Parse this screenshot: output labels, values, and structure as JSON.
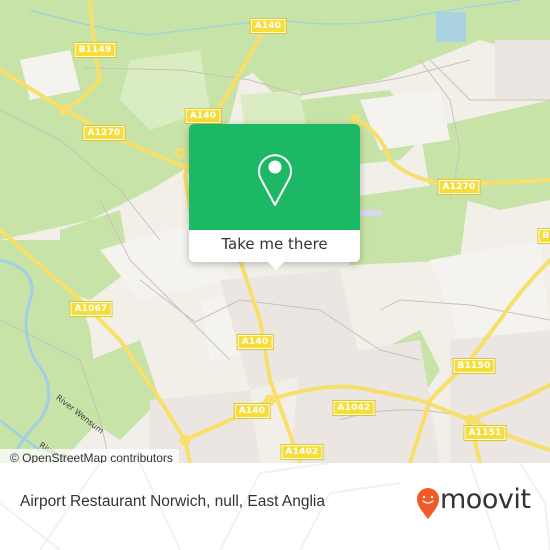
{
  "map": {
    "road_labels": [
      {
        "id": "b1149",
        "text": "B1149"
      },
      {
        "id": "a140-top",
        "text": "A140"
      },
      {
        "id": "a140-mid",
        "text": "A140"
      },
      {
        "id": "a1270-left",
        "text": "A1270"
      },
      {
        "id": "a1270-right",
        "text": "A1270"
      },
      {
        "id": "a1067",
        "text": "A1067"
      },
      {
        "id": "a140-lower",
        "text": "A140"
      },
      {
        "id": "a140-bottom",
        "text": "A140"
      },
      {
        "id": "a1042",
        "text": "A1042"
      },
      {
        "id": "b1150",
        "text": "B1150"
      },
      {
        "id": "a1151",
        "text": "A1151"
      },
      {
        "id": "a1402",
        "text": "A1402"
      },
      {
        "id": "b-edge",
        "text": "B"
      }
    ],
    "river_labels": [
      {
        "id": "wensum",
        "text": "River Wensum"
      },
      {
        "id": "tud",
        "text": "River Tud"
      }
    ],
    "attribution": "© OpenStreetMap contributors"
  },
  "popup": {
    "icon": "map-pin-icon",
    "button_label": "Take me there",
    "accent_color": "#1db866"
  },
  "footer": {
    "place_name": "Airport Restaurant Norwich, null, East Anglia",
    "brand": "moovit",
    "brand_color": "#f15a29"
  }
}
